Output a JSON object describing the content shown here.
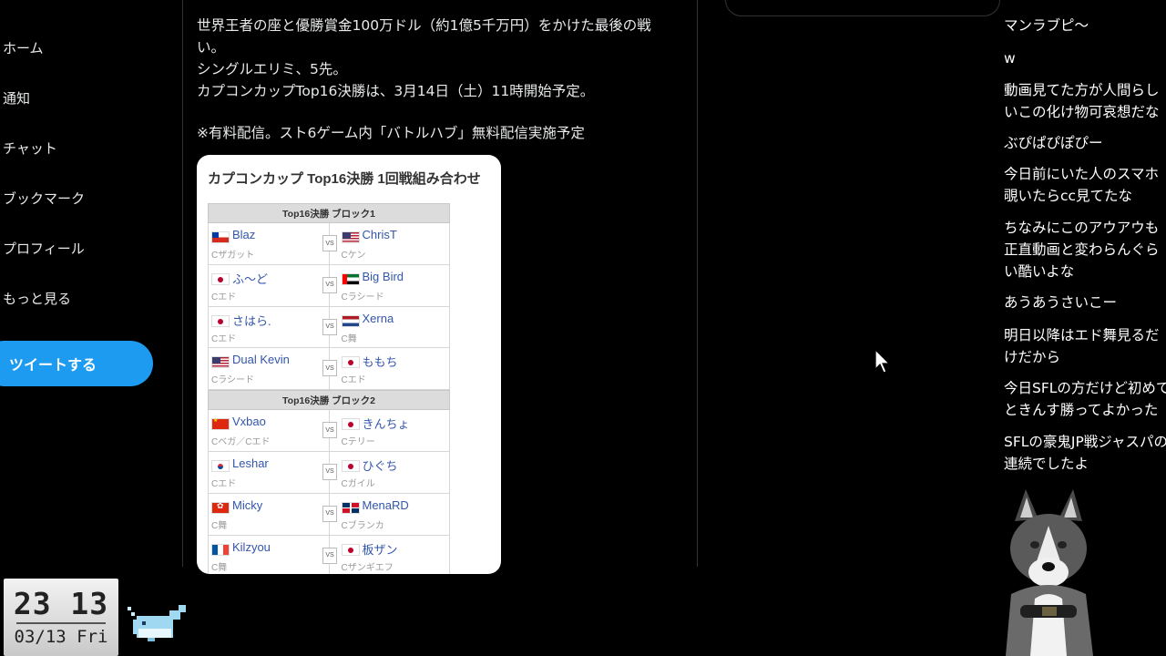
{
  "nav": {
    "items": [
      "ホーム",
      "通知",
      "チャット",
      "ブックマーク",
      "プロフィール",
      "もっと見る"
    ],
    "tweet_button": "ツイートする"
  },
  "tweet": {
    "lines": [
      "世界王者の座と優勝賞金100万ドル（約1億5千万円）をかけた最後の戦",
      "い。",
      "シングルエリミ、5先。",
      "カプコンカップTop16決勝は、3月14日（土）11時開始予定。"
    ],
    "notice": "※有料配信。スト6ゲーム内「バトルハブ」無料配信実施予定"
  },
  "bracket": {
    "title": "カプコンカップ Top16決勝 1回戦組み合わせ",
    "vs_label": "VS",
    "blocks": [
      {
        "header": "Top16決勝 ブロック1",
        "matches": [
          {
            "p1": {
              "name": "Blaz",
              "char": "Cザガット",
              "flag": "cl"
            },
            "p2": {
              "name": "ChrisT",
              "char": "Cケン",
              "flag": "us"
            }
          },
          {
            "p1": {
              "name": "ふ～ど",
              "char": "Cエド",
              "flag": "jp"
            },
            "p2": {
              "name": "Big Bird",
              "char": "Cラシード",
              "flag": "ae"
            }
          },
          {
            "p1": {
              "name": "さはら.",
              "char": "Cエド",
              "flag": "jp"
            },
            "p2": {
              "name": "Xerna",
              "char": "C舞",
              "flag": "nl"
            }
          },
          {
            "p1": {
              "name": "Dual Kevin",
              "char": "Cラシード",
              "flag": "us"
            },
            "p2": {
              "name": "ももち",
              "char": "Cエド",
              "flag": "jp"
            }
          }
        ]
      },
      {
        "header": "Top16決勝 ブロック2",
        "matches": [
          {
            "p1": {
              "name": "Vxbao",
              "char": "Cベガ／Cエド",
              "flag": "cn"
            },
            "p2": {
              "name": "きんちょ",
              "char": "Cテリー",
              "flag": "jp"
            }
          },
          {
            "p1": {
              "name": "Leshar",
              "char": "Cエド",
              "flag": "kr"
            },
            "p2": {
              "name": "ひぐち",
              "char": "Cガイル",
              "flag": "jp"
            }
          },
          {
            "p1": {
              "name": "Micky",
              "char": "C舞",
              "flag": "hk"
            },
            "p2": {
              "name": "MenaRD",
              "char": "Cブランカ",
              "flag": "do"
            }
          },
          {
            "p1": {
              "name": "Kilzyou",
              "char": "C舞",
              "flag": "fr"
            },
            "p2": {
              "name": "板ザン",
              "char": "Cザンギエフ",
              "flag": "jp"
            }
          }
        ]
      }
    ]
  },
  "chat": [
    "マンラブピ～",
    "w",
    "動画見てた方が人間らし\nいこの化け物可哀想だな",
    "ぶぴぱぴぽぴー",
    "今日前にいた人のスマホ\n覗いたらcc見てたな",
    "ちなみにこのアウアウも\n正直動画と変わらんぐら\nい酷いよな",
    "あうあうさいこー",
    "明日以降はエド舞見るだ\nけだから",
    "今日SFLの方だけど初めて\nときんす勝ってよかった",
    "SFLの豪鬼JP戦ジャスパの\n連続でしたよ"
  ],
  "clock": {
    "time": "23 13",
    "date": "03/13 Fri"
  },
  "icons": {
    "cursor": "mouse-pointer-icon",
    "whale": "whale-pixel-icon",
    "dog": "husky-avatar"
  },
  "colors": {
    "accent": "#1d9bf0",
    "background": "#000000",
    "text": "#e7e9ea"
  }
}
